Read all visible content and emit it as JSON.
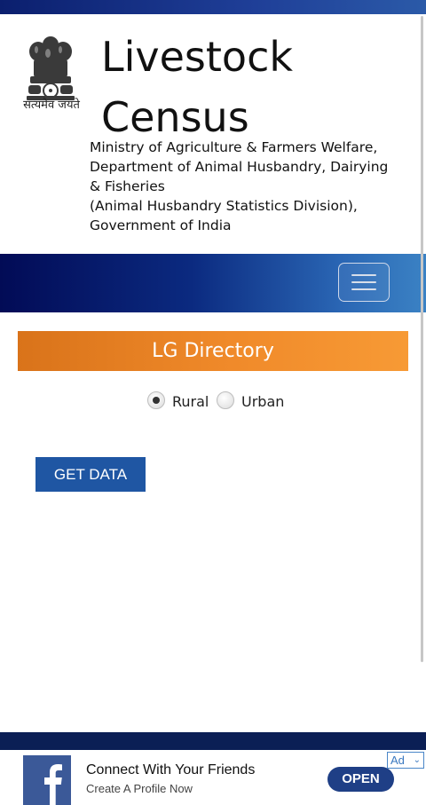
{
  "header": {
    "motto": "सत्यमेव जयते",
    "title_line1": "Livestock",
    "title_line2": "Census",
    "ministry_lines": [
      "Ministry of Agriculture & Farmers Welfare,",
      "Department of Animal Husbandry, Dairying",
      "& Fisheries",
      "(Animal Husbandry Statistics Division),",
      "Government of India"
    ]
  },
  "navbar": {
    "menu_icon": "hamburger-menu-icon"
  },
  "main": {
    "section_title": "LG Directory",
    "radio_options": [
      {
        "label": "Rural",
        "checked": true
      },
      {
        "label": "Urban",
        "checked": false
      }
    ],
    "get_data_label": "GET DATA"
  },
  "ad": {
    "title": "Connect With Your Friends",
    "subtitle": "Create A Profile Now",
    "open_label": "OPEN",
    "badge_label": "Ad",
    "badge_chevron": "⌄",
    "logo_icon": "facebook-logo-icon"
  },
  "colors": {
    "navbar_dark": "#020b56",
    "navbar_light": "#3b82c4",
    "section_orange": "#f08a2a",
    "button_blue": "#1f56a3",
    "facebook_blue": "#3b5998"
  }
}
